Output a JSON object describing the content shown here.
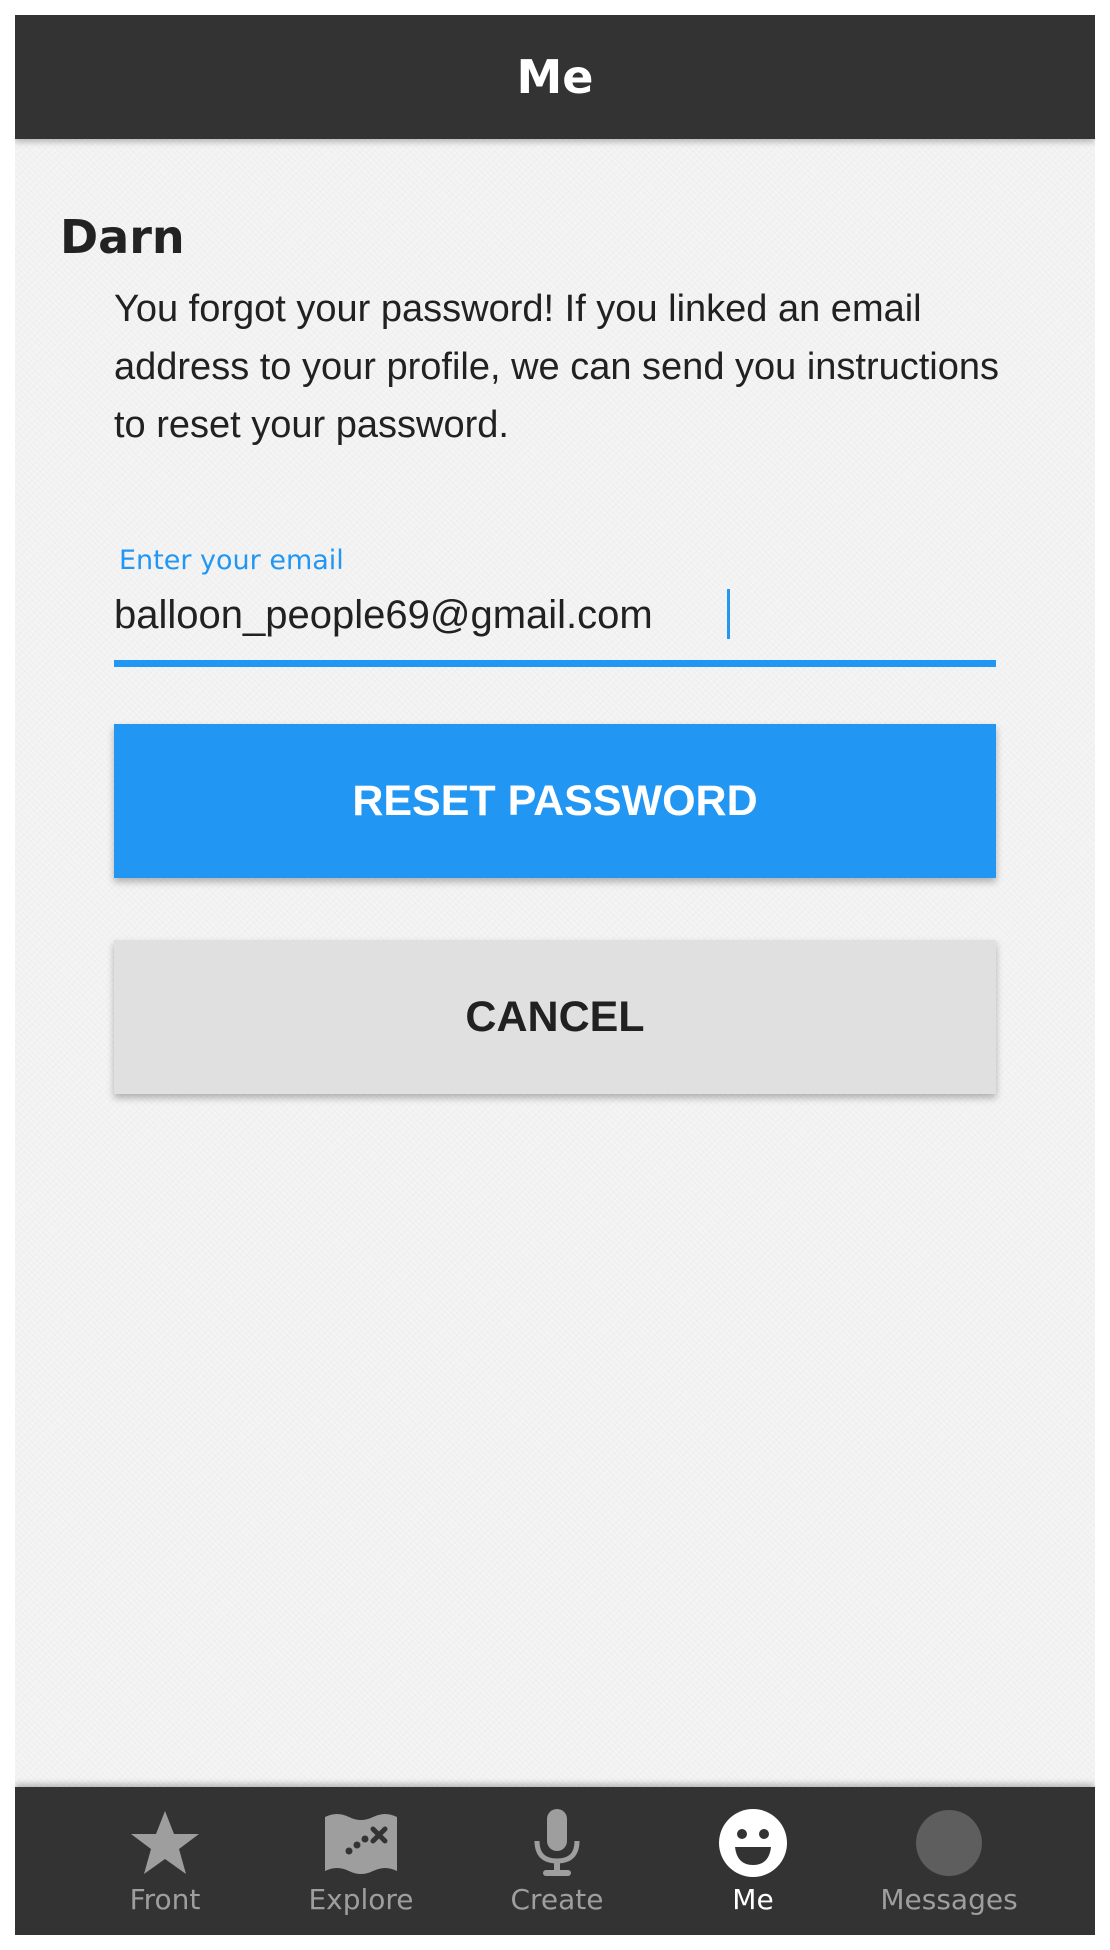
{
  "app_bar": {
    "title": "Me"
  },
  "content": {
    "heading": "Darn",
    "message": "You forgot your password! If you linked an email address to your profile, we can send you instructions to reset your password.",
    "email_field": {
      "label": "Enter your email",
      "value": "balloon_people69@gmail.com"
    },
    "reset_button": "RESET PASSWORD",
    "cancel_button": "CANCEL"
  },
  "bottom_nav": {
    "active": "Me",
    "items": [
      {
        "label": "Front",
        "icon": "star-icon"
      },
      {
        "label": "Explore",
        "icon": "map-icon"
      },
      {
        "label": "Create",
        "icon": "microphone-icon"
      },
      {
        "label": "Me",
        "icon": "smiley-face-icon"
      },
      {
        "label": "Messages",
        "icon": "circle-avatar-icon"
      }
    ]
  },
  "colors": {
    "accent": "#2196f3",
    "app_bar": "#333333",
    "nav_inactive": "#9e9e9e",
    "cancel_bg": "#e0e0e0"
  }
}
